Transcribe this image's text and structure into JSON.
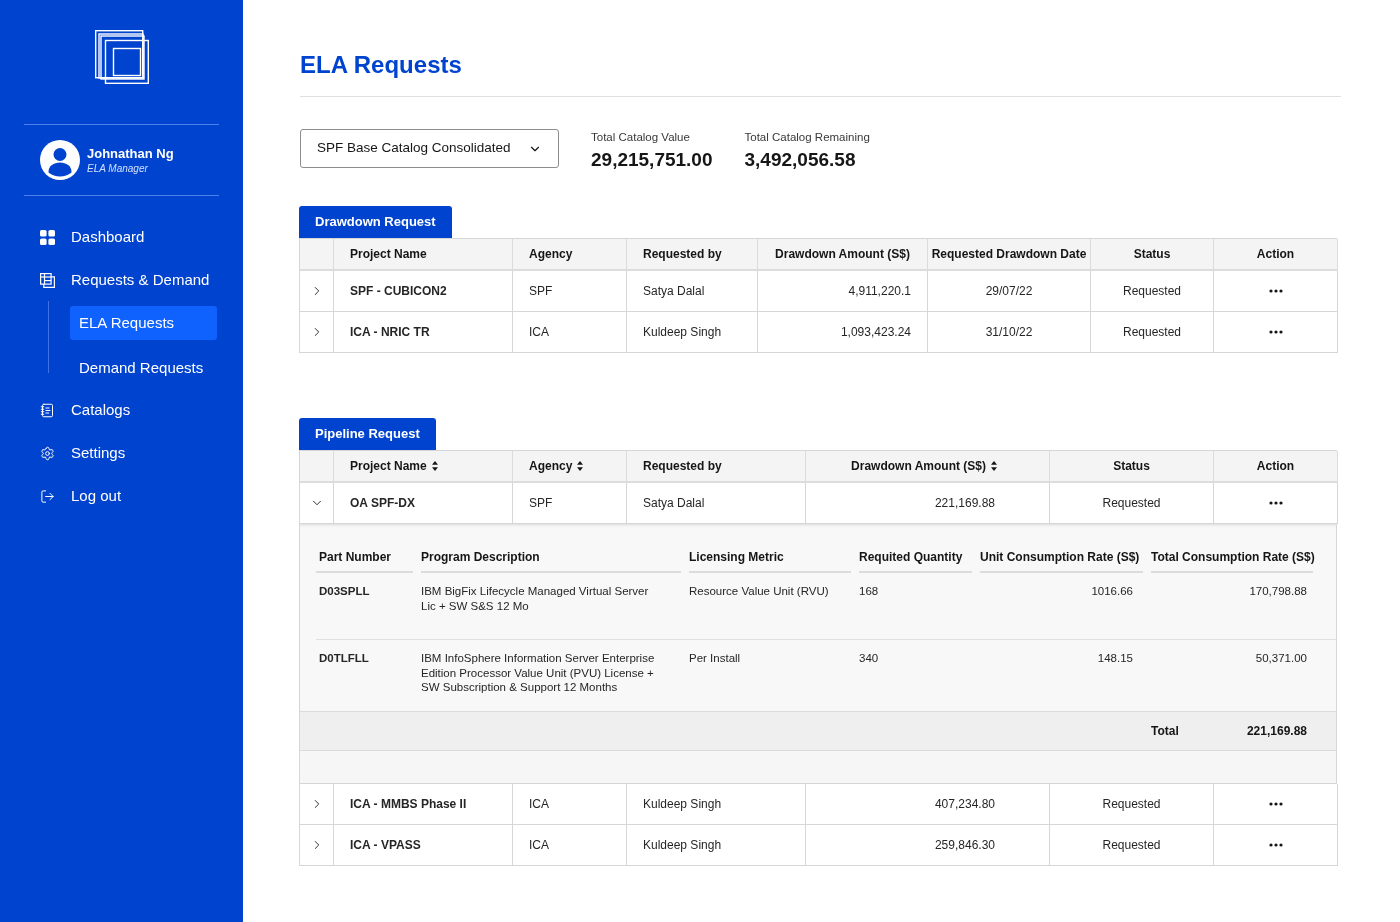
{
  "sidebar": {
    "user": {
      "name": "Johnathan Ng",
      "role": "ELA Manager"
    },
    "nav": [
      {
        "label": "Dashboard",
        "selected": false
      },
      {
        "label": "Requests & Demand",
        "selected": false,
        "children": [
          {
            "label": "ELA Requests",
            "selected": true
          },
          {
            "label": "Demand Requests",
            "selected": false
          }
        ]
      },
      {
        "label": "Catalogs",
        "selected": false
      },
      {
        "label": "Settings",
        "selected": false
      },
      {
        "label": "Log out",
        "selected": false
      }
    ]
  },
  "page": {
    "title": "ELA Requests"
  },
  "catalog_select": {
    "value": "SPF Base Catalog Consolidated"
  },
  "stats": [
    {
      "label": "Total Catalog Value",
      "value": "29,215,751.00"
    },
    {
      "label": "Total Catalog Remaining",
      "value": "3,492,056.58"
    }
  ],
  "drawdown": {
    "title": "Drawdown Request",
    "columns": [
      {
        "label": "Project Name",
        "sortable": false
      },
      {
        "label": "Agency",
        "sortable": false
      },
      {
        "label": "Requested by",
        "sortable": false
      },
      {
        "label": "Drawdown Amount (S$)",
        "sortable": false
      },
      {
        "label": "Requested Drawdown Date",
        "sortable": false
      },
      {
        "label": "Status",
        "sortable": false
      },
      {
        "label": "Action",
        "sortable": false
      }
    ],
    "rows": [
      {
        "expanded": false,
        "project_name": "SPF - CUBICON2",
        "agency": "SPF",
        "requested_by": "Satya Dalal",
        "drawdown_amount": "4,911,220.1",
        "requested_drawdown_date": "29/07/22",
        "status": "Requested"
      },
      {
        "expanded": false,
        "project_name": "ICA - NRIC TR",
        "agency": "ICA",
        "requested_by": "Kuldeep Singh",
        "drawdown_amount": "1,093,423.24",
        "requested_drawdown_date": "31/10/22",
        "status": "Requested"
      }
    ]
  },
  "pipeline": {
    "title": "Pipeline Request",
    "columns": [
      {
        "label": "Project Name",
        "sortable": true
      },
      {
        "label": "Agency",
        "sortable": true
      },
      {
        "label": "Requested by",
        "sortable": false
      },
      {
        "label": "Drawdown Amount (S$)",
        "sortable": true
      },
      {
        "label": "Status",
        "sortable": false
      },
      {
        "label": "Action",
        "sortable": false
      }
    ],
    "rows": [
      {
        "expanded": true,
        "project_name": "OA SPF-DX",
        "agency": "SPF",
        "requested_by": "Satya Dalal",
        "drawdown_amount": "221,169.88",
        "status": "Requested",
        "details": {
          "columns": [
            "Part Number",
            "Program Description",
            "Licensing Metric",
            "Requited Quantity",
            "Unit Consumption Rate (S$)",
            "Total Consumption Rate (S$)"
          ],
          "items": [
            {
              "part_number": "D03SPLL",
              "program_description": "IBM BigFix Lifecycle Managed Virtual Server Lic + SW S&S 12 Mo",
              "licensing_metric": "Resource Value Unit (RVU)",
              "required_quantity": "168",
              "unit_consumption_rate": "1016.66",
              "total_consumption_rate": "170,798.88"
            },
            {
              "part_number": "D0TLFLL",
              "program_description": "IBM InfoSphere Information Server Enterprise Edition Processor Value Unit (PVU) License + SW Subscription & Support 12 Months",
              "licensing_metric": "Per Install",
              "required_quantity": "340",
              "unit_consumption_rate": "148.15",
              "total_consumption_rate": "50,371.00"
            }
          ],
          "total": {
            "label": "Total",
            "value": "221,169.88"
          }
        }
      },
      {
        "expanded": false,
        "project_name": "ICA - MMBS Phase II",
        "agency": "ICA",
        "requested_by": "Kuldeep Singh",
        "drawdown_amount": "407,234.80",
        "status": "Requested"
      },
      {
        "expanded": false,
        "project_name": "ICA - VPASS",
        "agency": "ICA",
        "requested_by": "Kuldeep Singh",
        "drawdown_amount": "259,846.30",
        "status": "Requested"
      }
    ]
  }
}
